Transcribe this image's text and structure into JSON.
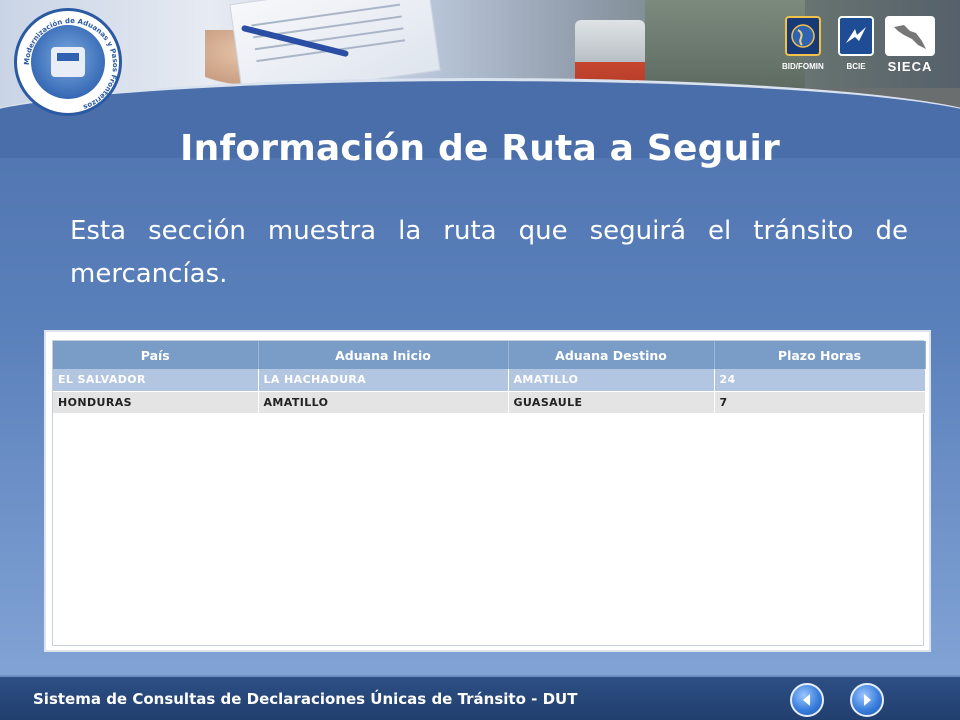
{
  "header": {
    "logo_text": "Modernización de Aduanas y Pasos Fronterizos",
    "sponsors": [
      {
        "name": "BID/FOMIN",
        "icon": "globe-icon"
      },
      {
        "name": "BCIE",
        "icon": "bird-icon"
      },
      {
        "name": "SIECA",
        "icon": "map-icon"
      }
    ]
  },
  "slide": {
    "title": "Información de Ruta a Seguir",
    "description": "Esta sección  muestra la ruta que seguirá el tránsito de mercancías."
  },
  "route_table": {
    "columns": [
      "País",
      "Aduana Inicio",
      "Aduana Destino",
      "Plazo Horas"
    ],
    "rows": [
      {
        "pais": "EL SALVADOR",
        "aduana_inicio": "LA HACHADURA",
        "aduana_destino": "AMATILLO",
        "plazo_horas": "24",
        "selected": true
      },
      {
        "pais": "HONDURAS",
        "aduana_inicio": "AMATILLO",
        "aduana_destino": "GUASAULE",
        "plazo_horas": "7",
        "selected": false
      }
    ]
  },
  "footer": {
    "text": "Sistema de Consultas de Declaraciones Únicas de Tránsito - DUT",
    "prev_icon": "arrow-left-icon",
    "next_icon": "arrow-right-icon"
  },
  "colors": {
    "background": "#5a80bb",
    "header_row": "#7a9dc8",
    "selected_row": "#b2c6e1",
    "normal_row": "#e4e4e4",
    "footer": "#2d4f85"
  }
}
